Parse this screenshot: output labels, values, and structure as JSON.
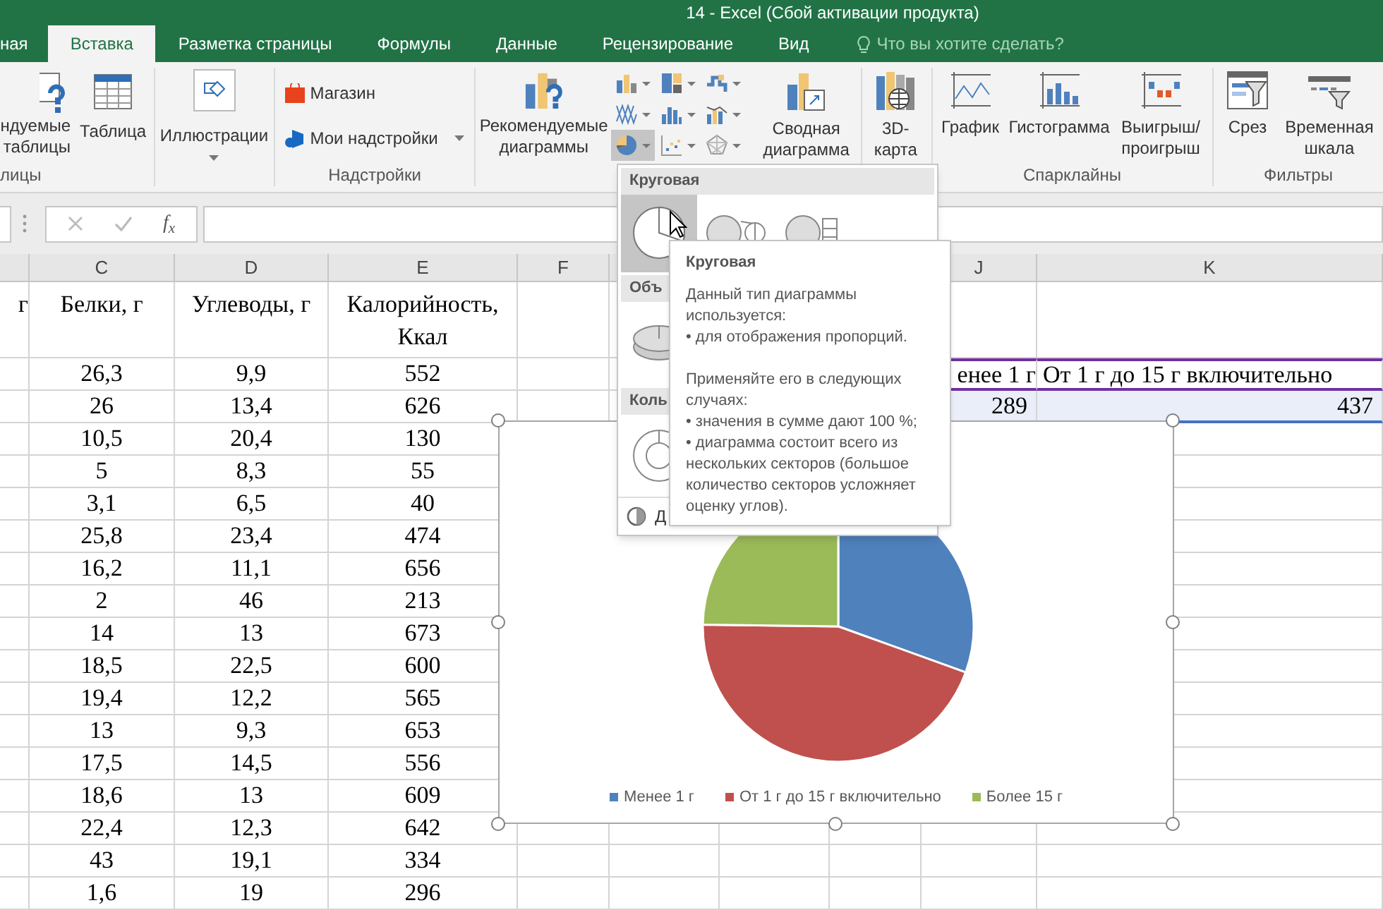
{
  "window": {
    "title": "14 - Excel (Сбой активации продукта)"
  },
  "ribbon_tabs": [
    {
      "label": "ная",
      "selected": false
    },
    {
      "label": "Вставка",
      "selected": true
    },
    {
      "label": "Разметка страницы",
      "selected": false
    },
    {
      "label": "Формулы",
      "selected": false
    },
    {
      "label": "Данные",
      "selected": false
    },
    {
      "label": "Рецензирование",
      "selected": false
    },
    {
      "label": "Вид",
      "selected": false
    }
  ],
  "tell_me": {
    "placeholder": "Что вы хотите сделать?"
  },
  "ribbon": {
    "groups": [
      {
        "label": "лицы",
        "buttons": [
          {
            "label": "ндуемые\nтаблицы"
          },
          {
            "label": "Таблица"
          }
        ]
      },
      {
        "buttons": [
          {
            "label": "Иллюстрации"
          }
        ]
      },
      {
        "label": "Надстройки",
        "buttons": [
          {
            "label": "Магазин"
          },
          {
            "label": "Мои надстройки"
          }
        ]
      },
      {
        "buttons": [
          {
            "label": "Рекомендуемые\nдиаграммы"
          },
          {
            "label": "Сводная\nдиаграмма"
          }
        ],
        "chart_type_buttons": [
          {
            "selected": false
          },
          {
            "selected": false
          },
          {
            "selected": false
          },
          {
            "selected": false
          },
          {
            "selected": false
          },
          {
            "selected": false
          },
          {
            "selected": true
          },
          {
            "selected": false
          },
          {
            "selected": false
          }
        ]
      },
      {
        "buttons": [
          {
            "label": "3D-\nкарта"
          }
        ]
      },
      {
        "label": "Спарклайны",
        "buttons": [
          {
            "label": "График"
          },
          {
            "label": "Гистограмма"
          },
          {
            "label": "Выигрыш/\nпроигрыш"
          }
        ]
      },
      {
        "label": "Фильтры",
        "buttons": [
          {
            "label": "Срез"
          },
          {
            "label": "Временная\nшкала"
          }
        ]
      }
    ]
  },
  "formula_bar": {
    "function_button": "f$_{x}$"
  },
  "sheet": {
    "column_headers": [
      "C",
      "D",
      "E",
      "F",
      "J",
      "K"
    ],
    "header_row": [
      "г",
      "Белки, г",
      "Углеводы, г",
      "Калорийность, Ккал"
    ],
    "rows": [
      {
        "c": "26,3",
        "d": "9,9",
        "e": "552"
      },
      {
        "c": "26",
        "d": "13,4",
        "e": "626"
      },
      {
        "c": "10,5",
        "d": "20,4",
        "e": "130"
      },
      {
        "c": "5",
        "d": "8,3",
        "e": "55"
      },
      {
        "c": "3,1",
        "d": "6,5",
        "e": "40"
      },
      {
        "c": "25,8",
        "d": "23,4",
        "e": "474"
      },
      {
        "c": "16,2",
        "d": "11,1",
        "e": "656"
      },
      {
        "c": "2",
        "d": "46",
        "e": "213"
      },
      {
        "c": "14",
        "d": "13",
        "e": "673"
      },
      {
        "c": "18,5",
        "d": "22,5",
        "e": "600"
      },
      {
        "c": "19,4",
        "d": "12,2",
        "e": "565"
      },
      {
        "c": "13",
        "d": "9,3",
        "e": "653"
      },
      {
        "c": "17,5",
        "d": "14,5",
        "e": "556"
      },
      {
        "c": "18,6",
        "d": "13",
        "e": "609"
      },
      {
        "c": "22,4",
        "d": "12,3",
        "e": "642"
      },
      {
        "c": "43",
        "d": "19,1",
        "e": "334"
      },
      {
        "c": "1,6",
        "d": "19",
        "e": "296"
      }
    ],
    "summary_table": {
      "headers": [
        "енее 1 г",
        "От 1 г до 15 г включительно"
      ],
      "values": [
        "289",
        "437"
      ]
    }
  },
  "chart": {
    "legend": [
      {
        "label": "Менее 1 г",
        "color": "#4f81bd"
      },
      {
        "label": "От 1 г до 15 г включительно",
        "color": "#c0504d"
      },
      {
        "label": "Более 15 г",
        "color": "#9bbb59"
      }
    ]
  },
  "chart_dropdown": {
    "sections": [
      {
        "title": "Круговая",
        "options": [
          {
            "selected": true
          },
          {
            "selected": false
          },
          {
            "selected": false
          }
        ]
      },
      {
        "title": "Объ",
        "options": [
          {
            "selected": false
          }
        ]
      },
      {
        "title": "Коль",
        "options": [
          {
            "selected": false
          }
        ]
      }
    ],
    "footer": "Д"
  },
  "tooltip": {
    "title": "Круговая",
    "paragraphs": [
      [
        "Данный тип диаграммы используется:",
        "• для отображения пропорций."
      ],
      [
        "Применяйте его в следующих случаях:",
        "• значения в сумме дают 100 %;",
        "• диаграмма состоит всего из нескольких секторов (большое количество секторов усложняет оценку углов)."
      ]
    ]
  }
}
